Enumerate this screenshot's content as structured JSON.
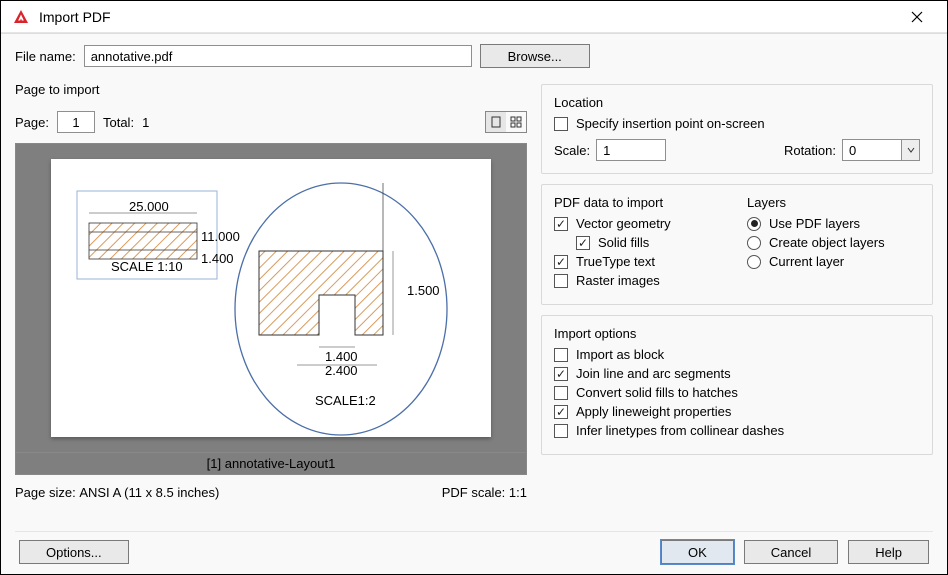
{
  "window": {
    "title": "Import PDF"
  },
  "file": {
    "label": "File name:",
    "value": "annotative.pdf",
    "browse": "Browse..."
  },
  "page_import": {
    "heading": "Page to import",
    "page_label": "Page:",
    "page_value": "1",
    "total_label": "Total:",
    "total_value": "1",
    "caption": "[1] annotative-Layout1",
    "size_label": "Page size:",
    "size_value": "ANSI A (11 x 8.5 inches)",
    "scale_label": "PDF scale:",
    "scale_value": "1:1",
    "drawing": {
      "dim_top": "25.000",
      "dim_right": "11.000",
      "dim_small": "1.400",
      "scale_text": "SCALE 1:10",
      "d1": "1.500",
      "d2": "1.400",
      "d3": "2.400",
      "scale2": "SCALE1:2"
    }
  },
  "location": {
    "heading": "Location",
    "specify": "Specify insertion point on-screen",
    "scale_label": "Scale:",
    "scale_value": "1",
    "rotation_label": "Rotation:",
    "rotation_value": "0"
  },
  "pdf_data": {
    "heading": "PDF data to import",
    "vector": "Vector geometry",
    "solid": "Solid fills",
    "truetype": "TrueType text",
    "raster": "Raster images"
  },
  "layers": {
    "heading": "Layers",
    "use_pdf": "Use PDF layers",
    "create_obj": "Create object layers",
    "current": "Current layer"
  },
  "options": {
    "heading": "Import options",
    "block": "Import as block",
    "join": "Join line and arc segments",
    "convert": "Convert solid fills to hatches",
    "lineweight": "Apply lineweight properties",
    "infer": "Infer linetypes from collinear dashes"
  },
  "buttons": {
    "options": "Options...",
    "ok": "OK",
    "cancel": "Cancel",
    "help": "Help"
  }
}
